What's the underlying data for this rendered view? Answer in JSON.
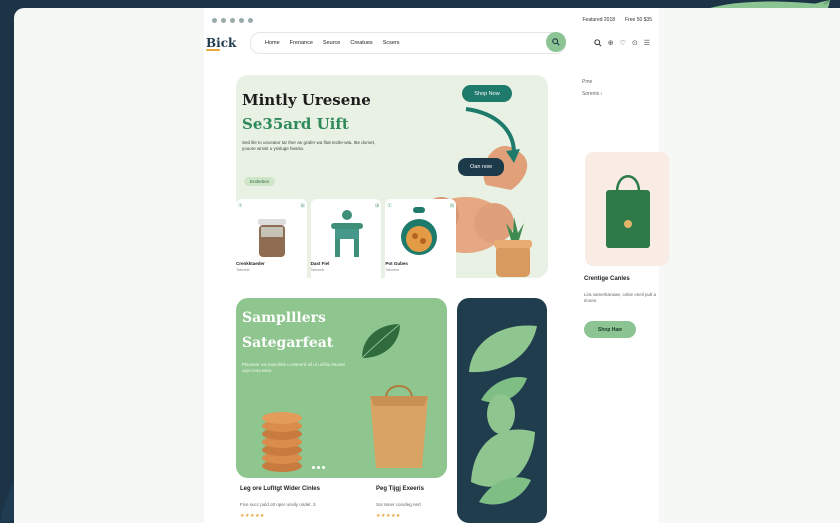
{
  "topbar": {
    "meta_left": "Featured 2018",
    "meta_right": "Free 50 $35"
  },
  "nav": {
    "logo": "Bick",
    "links": [
      "Home",
      "Frenance",
      "Seurce",
      "Creatues",
      "Scsers"
    ],
    "search_icon": "search-icon",
    "icons": [
      "search-icon",
      "user-icon",
      "heart-icon",
      "cart-icon",
      "menu-icon"
    ]
  },
  "hero": {
    "title": "Mintly Uresene",
    "subtitle": "Se35ard Uift",
    "body": "Sed ille to unceator tar ther an grafer wa fitat tectle-wta. Itte dorset, youore wrssit u yssluge hearta.",
    "small_button": "Enderties",
    "shop_now": "Shop Now",
    "dark_pill": "Oan now"
  },
  "products": [
    {
      "name": "Crenkktaeder",
      "sub": "Taborest"
    },
    {
      "name": "Dast Fiel",
      "sub": "Taborest"
    },
    {
      "name": "Pot Gubes",
      "sub": "Taborest"
    }
  ],
  "side": {
    "meta": [
      "Pme",
      "Sorents"
    ],
    "product_title": "Crentige Canles",
    "product_text": "Lira sameritaraiae, cekie oneil pult a imoes.",
    "button": "Shop Haw"
  },
  "promo": {
    "title": "Samplllers",
    "subtitle": "Sategarfeat",
    "body": "Placeser ust inanchtie u-seteerd oil ut unfitiu intuset urpn iena tarar.",
    "card1_title": "Leg ore Lufitgt Wider Cinles",
    "card1_sub": "Fice succ puld ott oper unsily ondet. 3",
    "card2_title": "Peg Tijgj Exeeris",
    "card2_sub": "Sor tener conofeg nert"
  },
  "colors": {
    "bg": "#1c3445",
    "accent_green": "#8cc494",
    "dark_teal": "#1e7a6a",
    "navy": "#1d3a4b"
  }
}
